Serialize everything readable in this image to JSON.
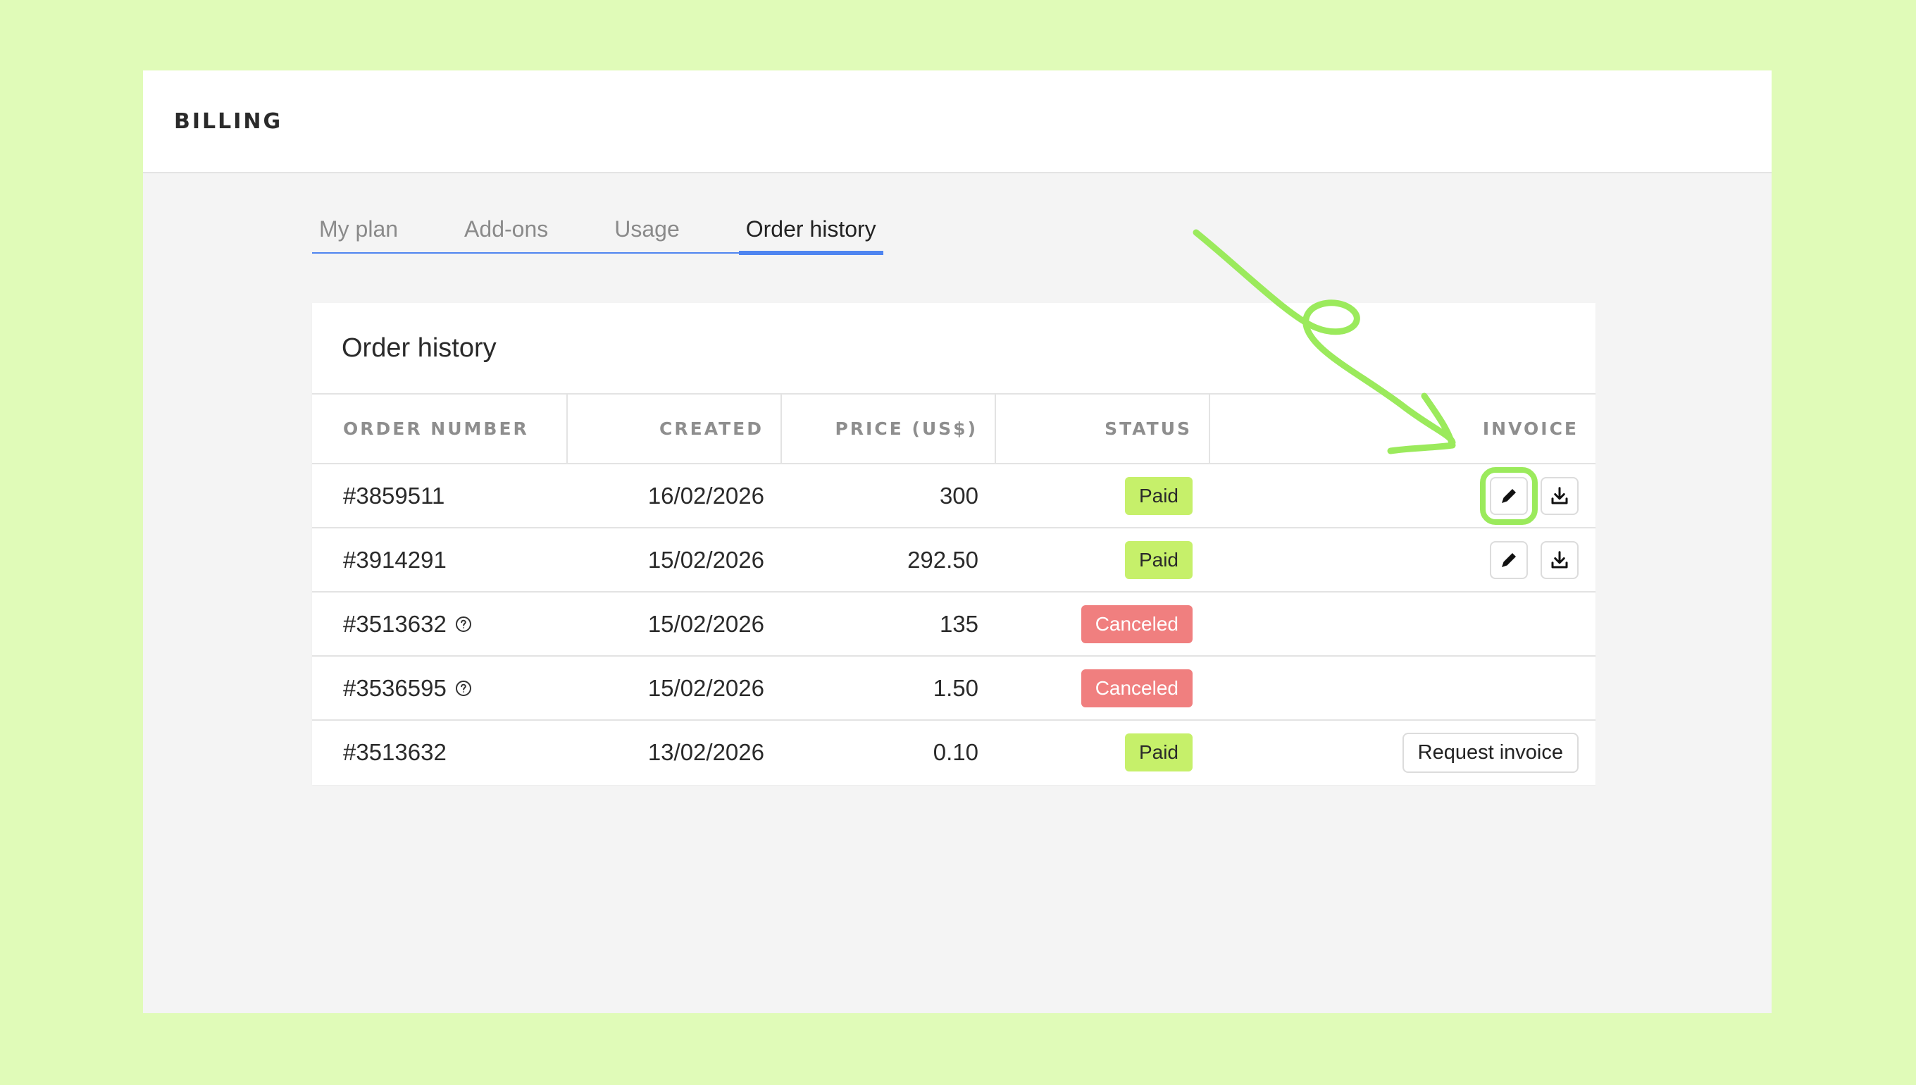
{
  "app": {
    "title": "BILLING"
  },
  "tabs": [
    {
      "label": "My plan",
      "active": false
    },
    {
      "label": "Add-ons",
      "active": false
    },
    {
      "label": "Usage",
      "active": false
    },
    {
      "label": "Order history",
      "active": true
    }
  ],
  "card": {
    "title": "Order history"
  },
  "table": {
    "headers": {
      "order_number": "ORDER NUMBER",
      "created": "CREATED",
      "price": "PRICE (US$)",
      "status": "STATUS",
      "invoice": "INVOICE"
    },
    "rows": [
      {
        "order": "#3859511",
        "created": "16/02/2026",
        "price": "300",
        "status": "Paid",
        "help_icon": false,
        "invoice": "icons"
      },
      {
        "order": "#3914291",
        "created": "15/02/2026",
        "price": "292.50",
        "status": "Paid",
        "help_icon": false,
        "invoice": "icons"
      },
      {
        "order": "#3513632",
        "created": "15/02/2026",
        "price": "135",
        "status": "Canceled",
        "help_icon": true,
        "invoice": "none"
      },
      {
        "order": "#3536595",
        "created": "15/02/2026",
        "price": "1.50",
        "status": "Canceled",
        "help_icon": true,
        "invoice": "none"
      },
      {
        "order": "#3513632",
        "created": "13/02/2026",
        "price": "0.10",
        "status": "Paid",
        "help_icon": false,
        "invoice": "request"
      }
    ],
    "request_invoice_label": "Request invoice"
  },
  "icons": {
    "edit": "pencil-icon",
    "download": "download-icon",
    "help": "question-circle-icon"
  },
  "colors": {
    "background": "#e0fbb8",
    "accent": "#4f85f0",
    "paid_badge": "#c6f06a",
    "canceled_badge": "#f07f7f",
    "annotation": "#9bea5c"
  }
}
